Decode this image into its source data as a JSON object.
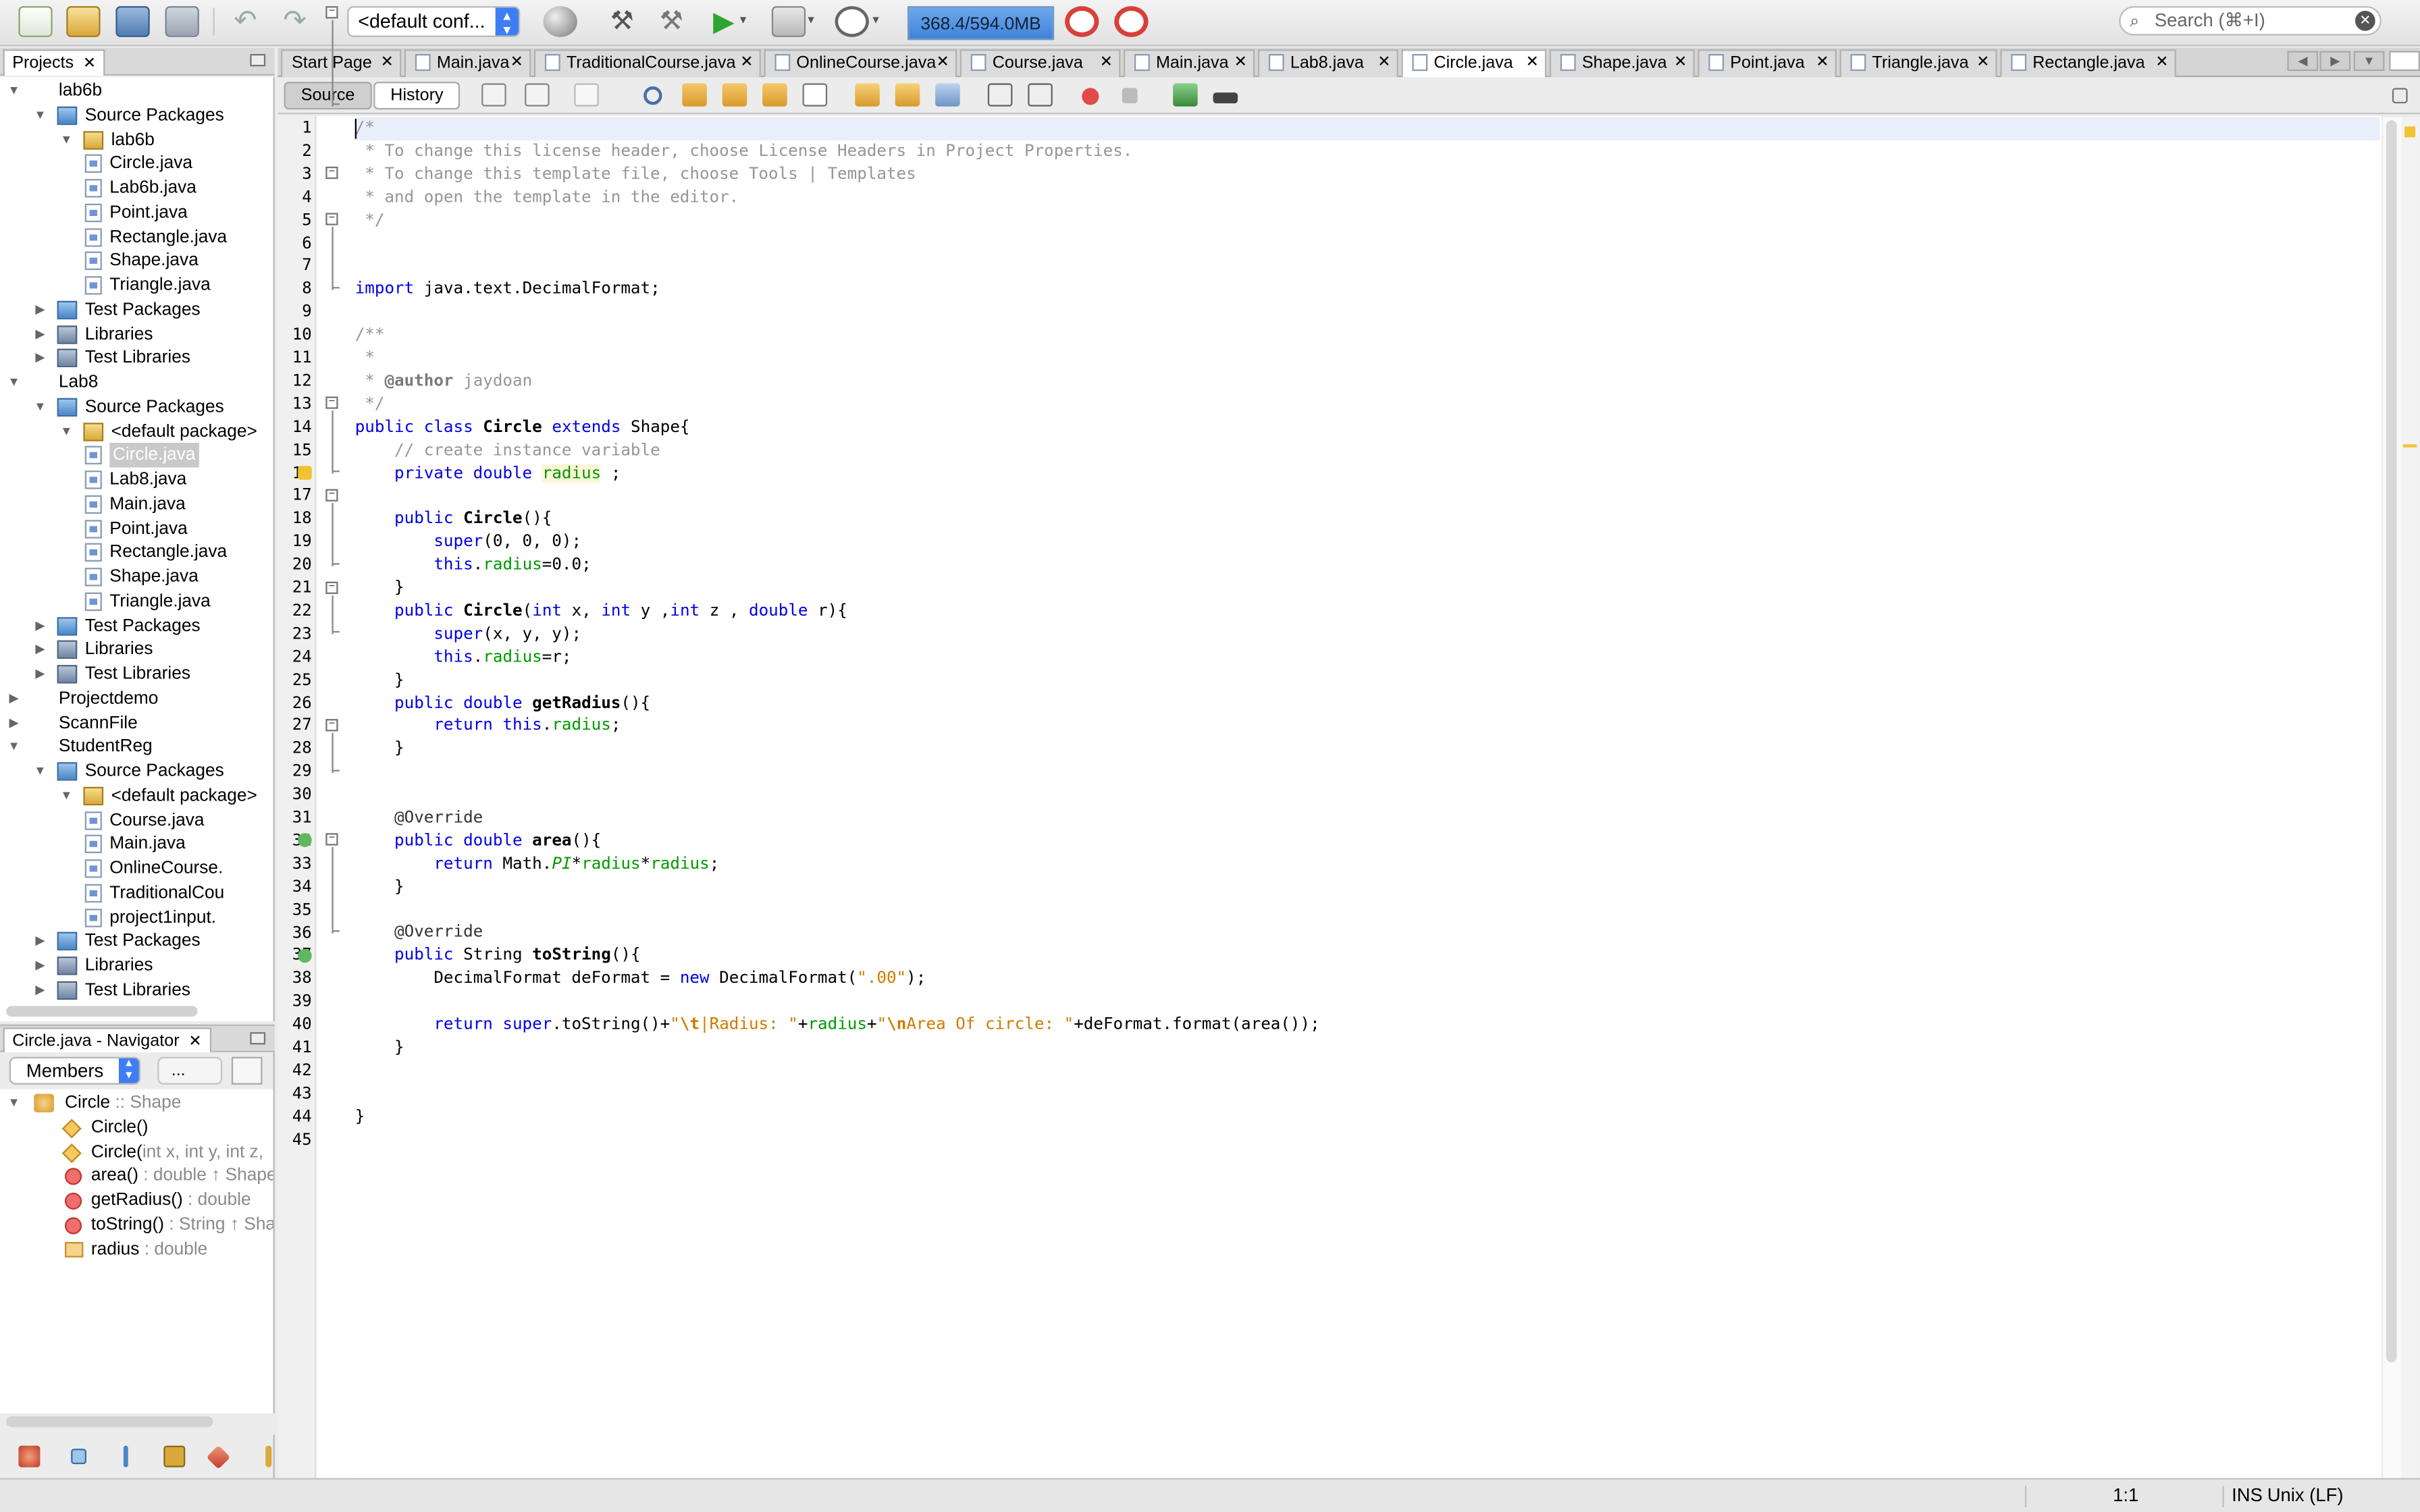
{
  "toolbar": {
    "config": "<default conf...",
    "memory": "368.4/594.0MB",
    "search_placeholder": "Search (⌘+I)"
  },
  "projects_panel": {
    "tab": "Projects",
    "tree": [
      {
        "label": "lab6b",
        "kind": "project",
        "depth": 0,
        "open": true
      },
      {
        "label": "Source Packages",
        "kind": "pkgs",
        "depth": 1,
        "open": true
      },
      {
        "label": "lab6b",
        "kind": "pkg",
        "depth": 2,
        "open": true
      },
      {
        "label": "Circle.java",
        "kind": "file",
        "depth": 3
      },
      {
        "label": "Lab6b.java",
        "kind": "file",
        "depth": 3
      },
      {
        "label": "Point.java",
        "kind": "file",
        "depth": 3
      },
      {
        "label": "Rectangle.java",
        "kind": "file",
        "depth": 3
      },
      {
        "label": "Shape.java",
        "kind": "file",
        "depth": 3
      },
      {
        "label": "Triangle.java",
        "kind": "file",
        "depth": 3
      },
      {
        "label": "Test Packages",
        "kind": "pkgs",
        "depth": 1,
        "open": false
      },
      {
        "label": "Libraries",
        "kind": "lib",
        "depth": 1,
        "open": false
      },
      {
        "label": "Test Libraries",
        "kind": "lib",
        "depth": 1,
        "open": false
      },
      {
        "label": "Lab8",
        "kind": "project",
        "depth": 0,
        "open": true
      },
      {
        "label": "Source Packages",
        "kind": "pkgs",
        "depth": 1,
        "open": true
      },
      {
        "label": "<default package>",
        "kind": "pkg",
        "depth": 2,
        "open": true
      },
      {
        "label": "Circle.java",
        "kind": "file",
        "depth": 3,
        "selected": true
      },
      {
        "label": "Lab8.java",
        "kind": "file",
        "depth": 3
      },
      {
        "label": "Main.java",
        "kind": "file",
        "depth": 3
      },
      {
        "label": "Point.java",
        "kind": "file",
        "depth": 3
      },
      {
        "label": "Rectangle.java",
        "kind": "file",
        "depth": 3
      },
      {
        "label": "Shape.java",
        "kind": "file",
        "depth": 3
      },
      {
        "label": "Triangle.java",
        "kind": "file",
        "depth": 3
      },
      {
        "label": "Test Packages",
        "kind": "pkgs",
        "depth": 1,
        "open": false
      },
      {
        "label": "Libraries",
        "kind": "lib",
        "depth": 1,
        "open": false
      },
      {
        "label": "Test Libraries",
        "kind": "lib",
        "depth": 1,
        "open": false
      },
      {
        "label": "Projectdemo",
        "kind": "project",
        "depth": 0,
        "open": false
      },
      {
        "label": "ScannFile",
        "kind": "project",
        "depth": 0,
        "open": false
      },
      {
        "label": "StudentReg",
        "kind": "project",
        "depth": 0,
        "open": true
      },
      {
        "label": "Source Packages",
        "kind": "pkgs",
        "depth": 1,
        "open": true
      },
      {
        "label": "<default package>",
        "kind": "pkg",
        "depth": 2,
        "open": true
      },
      {
        "label": "Course.java",
        "kind": "file",
        "depth": 3
      },
      {
        "label": "Main.java",
        "kind": "file",
        "depth": 3
      },
      {
        "label": "OnlineCourse.",
        "kind": "file",
        "depth": 3
      },
      {
        "label": "TraditionalCou",
        "kind": "file",
        "depth": 3
      },
      {
        "label": "project1input.",
        "kind": "file",
        "depth": 3
      },
      {
        "label": "Test Packages",
        "kind": "pkgs",
        "depth": 1,
        "open": false
      },
      {
        "label": "Libraries",
        "kind": "lib",
        "depth": 1,
        "open": false
      },
      {
        "label": "Test Libraries",
        "kind": "lib",
        "depth": 1,
        "open": false
      }
    ]
  },
  "navigator": {
    "tab": "Circle.java - Navigator",
    "filter": "Members",
    "dots": "...",
    "items": [
      {
        "name": "Circle",
        "suffix": " :: Shape",
        "kind": "cls",
        "depth": 0
      },
      {
        "name": "Circle()",
        "suffix": "",
        "kind": "ctor",
        "depth": 1
      },
      {
        "name": "Circle(",
        "suffix": "int x, int y, int z,",
        "kind": "ctor",
        "depth": 1
      },
      {
        "name": "area()",
        "suffix": " : double ↑ Shape",
        "kind": "meth",
        "depth": 1
      },
      {
        "name": "getRadius()",
        "suffix": " : double",
        "kind": "meth",
        "depth": 1
      },
      {
        "name": "toString()",
        "suffix": " : String ↑ Shap",
        "kind": "meth",
        "depth": 1
      },
      {
        "name": "radius",
        "suffix": " : double",
        "kind": "fld",
        "depth": 1
      }
    ]
  },
  "editor": {
    "tabs": [
      "Start Page",
      "Main.java",
      "TraditionalCourse.java",
      "OnlineCourse.java",
      "Course.java",
      "Main.java",
      "Lab8.java",
      "Circle.java",
      "Shape.java",
      "Point.java",
      "Triangle.java",
      "Rectangle.java"
    ],
    "active_tab": 7,
    "source_label": "Source",
    "history_label": "History",
    "line_count": 45
  },
  "status": {
    "position": "1:1",
    "mode": "INS",
    "line_ending": "Unix (LF)"
  }
}
